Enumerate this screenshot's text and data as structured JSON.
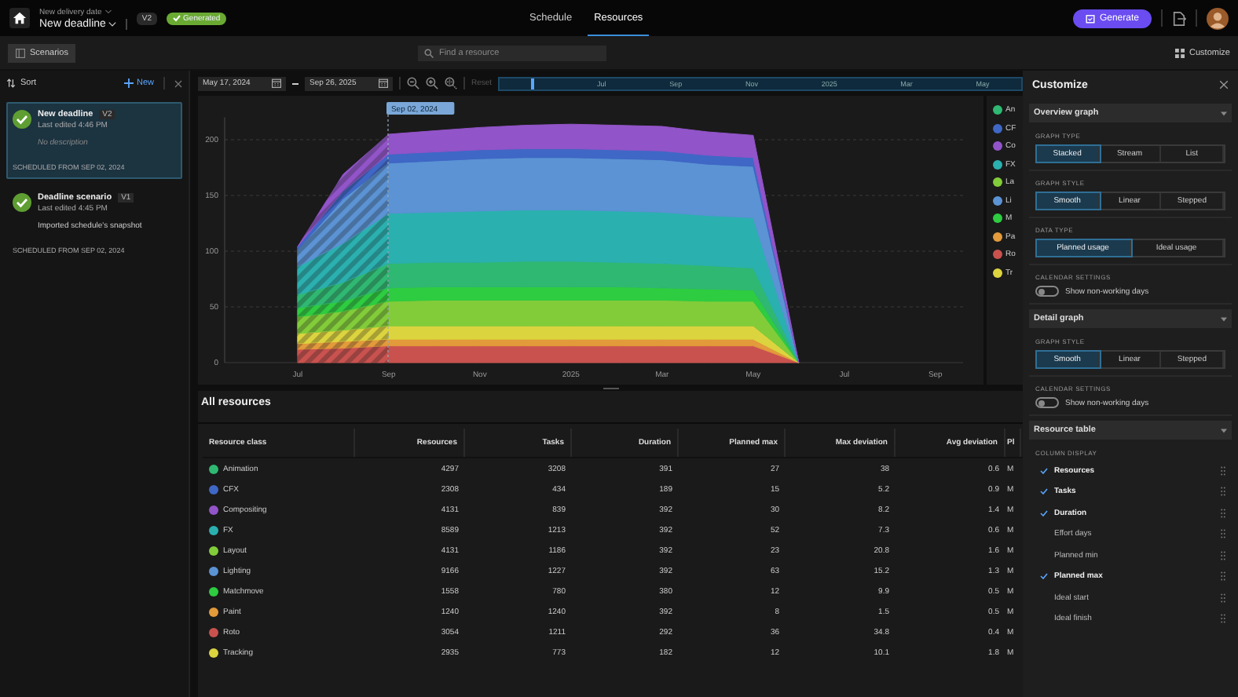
{
  "topbar": {
    "breadcrumb": "New delivery date",
    "title": "New deadline",
    "version": "V2",
    "status": "Generated",
    "tabs": [
      {
        "label": "Schedule",
        "selected": false
      },
      {
        "label": "Resources",
        "selected": true
      }
    ],
    "generate_button": "Generate"
  },
  "toolbar": {
    "scenarios_button": "Scenarios",
    "search": {
      "placeholder": "Find a resource"
    },
    "customize_button": "Customize"
  },
  "scenarios": {
    "sort_label": "Sort",
    "new_button": "New",
    "items": [
      {
        "name": "New deadline",
        "version": "V2",
        "edited": "Last edited 4:46 PM",
        "description": "No description",
        "empty_description": true,
        "scheduled": "SCHEDULED FROM SEP 02, 2024",
        "selected": true
      },
      {
        "name": "Deadline scenario",
        "version": "V1",
        "edited": "Last edited 4:45 PM",
        "description": "Imported schedule's snapshot",
        "empty_description": false,
        "scheduled": "SCHEDULED FROM SEP 02, 2024",
        "selected": false
      }
    ]
  },
  "timeline": {
    "start_date": "May 17, 2024",
    "end_date": "Sep 26, 2025",
    "reset": {
      "label": "Reset",
      "disabled": true
    },
    "labels": [
      "Jul",
      "Sep",
      "Nov",
      "2025",
      "Mar",
      "May"
    ]
  },
  "overview": {
    "start_marker": "Sep 02, 2024",
    "chart_data": {
      "type": "area",
      "stacked": true,
      "grid": true,
      "categories": [
        "Jul",
        null,
        "Sep",
        null,
        "Nov",
        null,
        "2025",
        null,
        "Mar",
        null,
        "May",
        null,
        "Jul",
        null,
        "Sep"
      ],
      "ylim": [
        0,
        220
      ],
      "yticks": [
        0,
        50,
        100,
        150,
        200
      ],
      "series": [
        {
          "color": "#c9524f",
          "values": [
            12,
            13,
            15,
            15,
            15,
            15,
            15,
            15,
            15,
            15,
            15,
            0,
            null,
            null,
            null
          ]
        },
        {
          "color": "#e39a3b",
          "values": [
            5,
            6,
            6,
            6,
            6,
            6,
            6,
            6,
            6,
            6,
            6,
            0,
            null,
            null,
            null
          ]
        },
        {
          "color": "#dcd43f",
          "values": [
            9,
            10,
            12,
            12,
            12,
            12,
            12,
            12,
            12,
            12,
            12,
            0,
            null,
            null,
            null
          ]
        },
        {
          "color": "#82cc3a",
          "values": [
            15,
            17,
            22,
            23,
            23,
            23,
            23,
            23,
            23,
            22,
            22,
            0,
            null,
            null,
            null
          ]
        },
        {
          "color": "#2ecc40",
          "values": [
            8,
            9,
            12,
            12,
            12,
            12,
            12,
            12,
            11,
            11,
            10,
            0,
            null,
            null,
            null
          ]
        },
        {
          "color": "#2fb872",
          "values": [
            12,
            17,
            22,
            22,
            22,
            23,
            23,
            22,
            22,
            21,
            20,
            0,
            null,
            null,
            null
          ]
        },
        {
          "color": "#2bb0b0",
          "values": [
            25,
            35,
            45,
            45,
            46,
            46,
            46,
            46,
            46,
            45,
            45,
            0,
            null,
            null,
            null
          ]
        },
        {
          "color": "#5b93d4",
          "values": [
            15,
            40,
            45,
            46,
            47,
            47,
            47,
            47,
            47,
            46,
            46,
            0,
            null,
            null,
            null
          ]
        },
        {
          "color": "#3f67c6",
          "values": [
            3,
            7,
            8,
            8,
            8,
            8,
            8,
            8,
            8,
            8,
            8,
            0,
            null,
            null,
            null
          ]
        },
        {
          "color": "#9254c9",
          "values": [
            0,
            15,
            18,
            19,
            20,
            21,
            22,
            22,
            22,
            21,
            20,
            0,
            null,
            null,
            null
          ]
        }
      ]
    },
    "legend": [
      {
        "label": "An",
        "color": "#2fb872"
      },
      {
        "label": "CF",
        "color": "#3f67c6"
      },
      {
        "label": "Co",
        "color": "#9254c9"
      },
      {
        "label": "FX",
        "color": "#2bb0b0"
      },
      {
        "label": "La",
        "color": "#82cc3a"
      },
      {
        "label": "Li",
        "color": "#5b93d4"
      },
      {
        "label": "M",
        "color": "#2ecc40"
      },
      {
        "label": "Pa",
        "color": "#e39a3b"
      },
      {
        "label": "Ro",
        "color": "#c9524f"
      },
      {
        "label": "Tr",
        "color": "#dcd43f"
      }
    ]
  },
  "table": {
    "title": "All resources",
    "columns": [
      "Resource class",
      "Resources",
      "Tasks",
      "Duration",
      "Planned max",
      "Max deviation",
      "Avg deviation",
      "Pl"
    ],
    "rows": [
      {
        "color": "#2fb872",
        "cells": [
          "Animation",
          "4297",
          "3208",
          "391",
          "27",
          "38",
          "0.6",
          "M"
        ]
      },
      {
        "color": "#3f67c6",
        "cells": [
          "CFX",
          "2308",
          "434",
          "189",
          "15",
          "5.2",
          "0.9",
          "M"
        ]
      },
      {
        "color": "#9254c9",
        "cells": [
          "Compositing",
          "4131",
          "839",
          "392",
          "30",
          "8.2",
          "1.4",
          "M"
        ]
      },
      {
        "color": "#2bb0b0",
        "cells": [
          "FX",
          "8589",
          "1213",
          "392",
          "52",
          "7.3",
          "0.6",
          "M"
        ]
      },
      {
        "color": "#82cc3a",
        "cells": [
          "Layout",
          "4131",
          "1186",
          "392",
          "23",
          "20.8",
          "1.6",
          "M"
        ]
      },
      {
        "color": "#5b93d4",
        "cells": [
          "Lighting",
          "9166",
          "1227",
          "392",
          "63",
          "15.2",
          "1.3",
          "M"
        ]
      },
      {
        "color": "#2ecc40",
        "cells": [
          "Matchmove",
          "1558",
          "780",
          "380",
          "12",
          "9.9",
          "0.5",
          "M"
        ]
      },
      {
        "color": "#e39a3b",
        "cells": [
          "Paint",
          "1240",
          "1240",
          "392",
          "8",
          "1.5",
          "0.5",
          "M"
        ]
      },
      {
        "color": "#c9524f",
        "cells": [
          "Roto",
          "3054",
          "1211",
          "292",
          "36",
          "34.8",
          "0.4",
          "M"
        ]
      },
      {
        "color": "#dcd43f",
        "cells": [
          "Tracking",
          "2935",
          "773",
          "182",
          "12",
          "10.1",
          "1.8",
          "M"
        ]
      }
    ]
  },
  "customize": {
    "title": "Customize",
    "sections": [
      {
        "title": "Overview graph",
        "expanded": true,
        "groups": [
          {
            "kind": "segmented",
            "label": "GRAPH TYPE",
            "options": [
              {
                "label": "Stacked",
                "selected": true
              },
              {
                "label": "Stream",
                "selected": false
              },
              {
                "label": "List",
                "selected": false
              }
            ]
          },
          {
            "kind": "segmented",
            "label": "GRAPH STYLE",
            "options": [
              {
                "label": "Smooth",
                "selected": true
              },
              {
                "label": "Linear",
                "selected": false
              },
              {
                "label": "Stepped",
                "selected": false
              }
            ]
          },
          {
            "kind": "segmented",
            "label": "DATA TYPE",
            "options": [
              {
                "label": "Planned usage",
                "selected": true
              },
              {
                "label": "Ideal usage",
                "selected": false
              }
            ]
          },
          {
            "kind": "toggle",
            "label": "CALENDAR SETTINGS",
            "text": "Show non-working days",
            "on": false
          }
        ]
      },
      {
        "title": "Detail graph",
        "expanded": true,
        "groups": [
          {
            "kind": "segmented",
            "label": "GRAPH STYLE",
            "options": [
              {
                "label": "Smooth",
                "selected": true
              },
              {
                "label": "Linear",
                "selected": false
              },
              {
                "label": "Stepped",
                "selected": false
              }
            ]
          },
          {
            "kind": "toggle",
            "label": "CALENDAR SETTINGS",
            "text": "Show non-working days",
            "on": false
          }
        ]
      },
      {
        "title": "Resource table",
        "expanded": true,
        "groups": [
          {
            "kind": "columns",
            "label": "COLUMN DISPLAY",
            "items": [
              {
                "label": "Resources",
                "checked": true
              },
              {
                "label": "Tasks",
                "checked": true
              },
              {
                "label": "Duration",
                "checked": true
              },
              {
                "label": "Effort days",
                "checked": false
              },
              {
                "label": "Planned min",
                "checked": false
              },
              {
                "label": "Planned max",
                "checked": true
              },
              {
                "label": "Ideal start",
                "checked": false
              },
              {
                "label": "Ideal finish",
                "checked": false
              }
            ]
          }
        ]
      }
    ]
  }
}
